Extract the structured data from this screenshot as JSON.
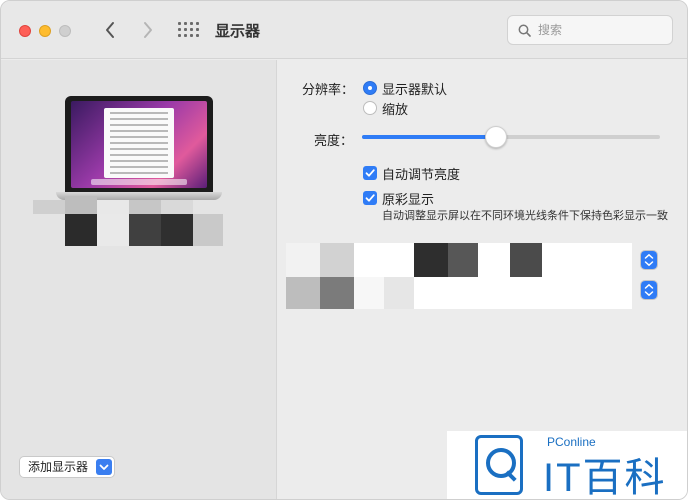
{
  "window": {
    "title": "显示器",
    "search_placeholder": "搜索"
  },
  "left": {
    "add_display_label": "添加显示器"
  },
  "settings": {
    "resolution_label": "分辨率：",
    "resolution_options": [
      {
        "label": "显示器默认",
        "selected": true
      },
      {
        "label": "缩放",
        "selected": false
      }
    ],
    "brightness_label": "亮度：",
    "brightness_level": 0.45,
    "auto_brightness_label": "自动调节亮度",
    "true_tone_label": "原彩显示",
    "true_tone_description": "自动调整显示屏以在不同环境光线条件下保持色彩显示一致"
  },
  "watermark": {
    "small": "PConline",
    "big": "IT百科"
  },
  "colors": {
    "accent": "#2f7cf6",
    "brand": "#1a6fc2"
  }
}
